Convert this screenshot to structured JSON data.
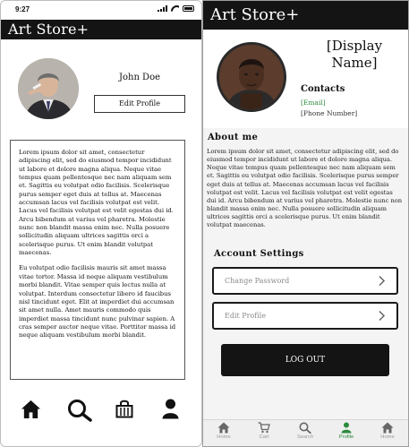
{
  "wireframe": {
    "status_bar": {
      "time": "9:27",
      "icons": [
        "signal-icon",
        "wifi-icon",
        "battery-icon"
      ]
    },
    "brand": "Art Store+",
    "profile": {
      "name": "John Doe",
      "edit_label": "Edit Profile"
    },
    "body_paragraphs": [
      "Lorem ipsum dolor sit amet, consectetur adipiscing elit, sed do eiusmod tempor incididunt ut labore et dolore magna aliqua. Neque vitae tempus quam pellentesque nec nam aliquam sem et. Sagittis eu volutpat odio facilisis. Scelerisque purus semper eget duis at tellus at. Maecenas accumsan lacus vel facilisis volutpat est velit. Lacus vel facilisis volutpat est velit egestas dui id. Arcu bibendum at varius vel pharetra. Molestie nunc non blandit massa enim nec. Nulla posuere sollicitudin aliquam ultrices sagittis orci a scelerisque purus. Ut enim blandit volutpat maecenas.",
      "Eu volutpat odio facilisis mauris sit amet massa vitae tortor. Massa id neque aliquam vestibulum morbi blandit. Vitae semper quis lectus nulla at volutpat. Interdum consectetur libero id faucibus nisl tincidunt eget. Elit at imperdiet dui accumsan sit amet nulla. Amet mauris commodo quis imperdiet massa tincidunt nunc pulvinar sapien. A cras semper auctor neque vitae. Porttitor massa id neque aliquam vestibulum morbi blandit."
    ],
    "nav_icons": [
      "home-icon",
      "search-icon",
      "shopping-bag-icon",
      "user-icon"
    ]
  },
  "app": {
    "brand": "Art Store+",
    "profile": {
      "display_name": "[Display Name]",
      "contacts_title": "Contacts",
      "email": "[Email]",
      "phone": "[Phone Number]"
    },
    "about": {
      "title": "About  me",
      "text": "Lorem ipsum dolor sit amet, consectetur adipiscing elit, sed do eiusmod tempor incididunt ut labore et dolore magna aliqua. Neque vitae tempus quam pellentesque nec nam aliquam sem et. Sagittis eu volutpat odio facilisis. Scelerisque purus semper eget duis at tellus at. Maecenas accumsan lacus vel facilisis volutpat est velit. Lacus vel facilisis volutpat est velit egestas dui id. Arcu bibendum at varius vel pharetra. Molestie nunc non blandit massa enim nec. Nulla posuere sollicitudin aliquam ultrices sagittis orci a scelerisque purus. Ut enim blandit volutpat maecenas."
    },
    "settings": {
      "title": "Account Settings",
      "change_password": "Change Password",
      "edit_profile": "Edit Profile",
      "logout": "LOG OUT"
    },
    "tabs": [
      {
        "label": "Home",
        "icon": "home-icon"
      },
      {
        "label": "Cart",
        "icon": "cart-icon"
      },
      {
        "label": "Search",
        "icon": "search-icon"
      },
      {
        "label": "Profile",
        "icon": "user-icon",
        "active": true
      },
      {
        "label": "Home",
        "icon": "home-icon"
      }
    ],
    "colors": {
      "accent": "#2e8b3d",
      "header": "#141414",
      "inactive_tab": "#9a9a9a"
    }
  }
}
